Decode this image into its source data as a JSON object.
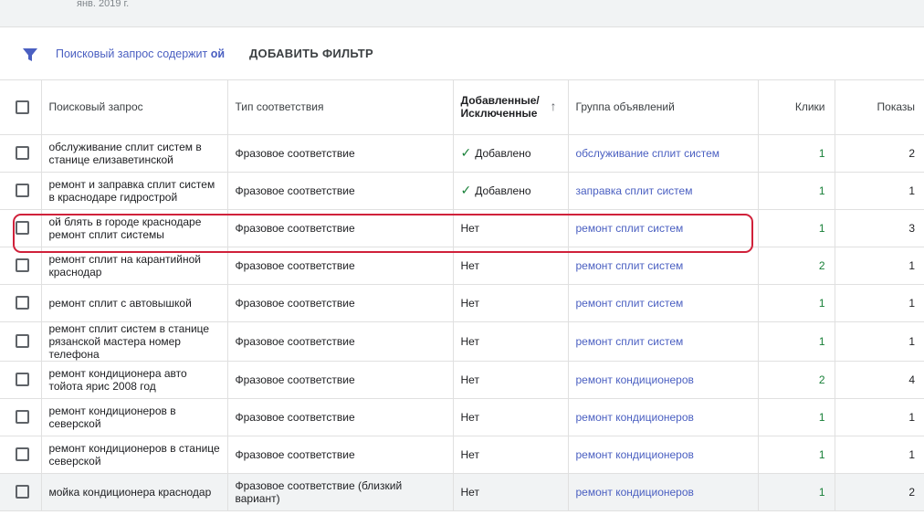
{
  "header": {
    "date_label": "янв. 2019 г."
  },
  "filter": {
    "prefix": "Поисковый запрос содержит",
    "value": "ой",
    "add_filter_label": "ДОБАВИТЬ ФИЛЬТР"
  },
  "table": {
    "columns": {
      "query": "Поисковый запрос",
      "match_type": "Тип соответствия",
      "added_line1": "Добавленные/",
      "added_line2": "Исключенные",
      "ad_group": "Группа объявлений",
      "clicks": "Клики",
      "impressions": "Показы"
    },
    "rows": [
      {
        "query": "обслуживание сплит систем в станице елизаветинской",
        "match": "Фразовое соответствие",
        "status": "Добавлено",
        "group": "обслуживание сплит систем",
        "clicks": "1",
        "impressions": "2"
      },
      {
        "query": "ремонт и заправка сплит систем в краснодаре гидрострой",
        "match": "Фразовое соответствие",
        "status": "Добавлено",
        "group": "заправка сплит систем",
        "clicks": "1",
        "impressions": "1"
      },
      {
        "query": "ой блять в городе краснодаре ремонт сплит системы",
        "match": "Фразовое соответствие",
        "status": "Нет",
        "group": "ремонт сплит систем",
        "clicks": "1",
        "impressions": "3"
      },
      {
        "query": "ремонт сплит на карантийной краснодар",
        "match": "Фразовое соответствие",
        "status": "Нет",
        "group": "ремонт сплит систем",
        "clicks": "2",
        "impressions": "1"
      },
      {
        "query": "ремонт сплит с автовышкой",
        "match": "Фразовое соответствие",
        "status": "Нет",
        "group": "ремонт сплит систем",
        "clicks": "1",
        "impressions": "1"
      },
      {
        "query": "ремонт сплит систем в станице рязанской мастера номер телефона",
        "match": "Фразовое соответствие",
        "status": "Нет",
        "group": "ремонт сплит систем",
        "clicks": "1",
        "impressions": "1"
      },
      {
        "query": "ремонт кондиционера авто тойота ярис 2008 год",
        "match": "Фразовое соответствие",
        "status": "Нет",
        "group": "ремонт кондиционеров",
        "clicks": "2",
        "impressions": "4"
      },
      {
        "query": "ремонт кондиционеров в северской",
        "match": "Фразовое соответствие",
        "status": "Нет",
        "group": "ремонт кондиционеров",
        "clicks": "1",
        "impressions": "1"
      },
      {
        "query": "ремонт кондиционеров в станице северской",
        "match": "Фразовое соответствие",
        "status": "Нет",
        "group": "ремонт кондиционеров",
        "clicks": "1",
        "impressions": "1"
      },
      {
        "query": "мойка кондиционера краснодар",
        "match": "Фразовое соответствие (близкий вариант)",
        "status": "Нет",
        "group": "ремонт кондиционеров",
        "clicks": "1",
        "impressions": "2"
      }
    ]
  },
  "colors": {
    "link": "#4a5fc1",
    "added_check": "#188038",
    "highlight_outline": "#d0213a"
  }
}
